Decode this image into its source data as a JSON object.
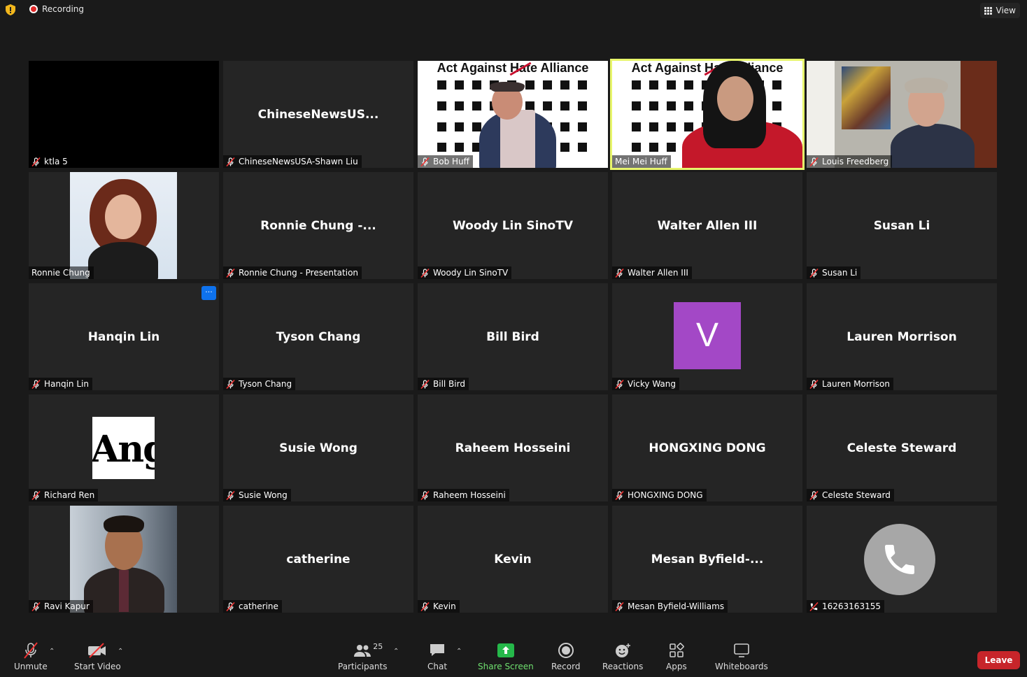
{
  "topbar": {
    "recording_label": "Recording",
    "view_label": "View"
  },
  "banner_text": "Act Against Hate Alliance",
  "tiles": [
    {
      "center": "",
      "name": "ktla 5"
    },
    {
      "center": "ChineseNewsUS...",
      "name": "ChineseNewsUSA-Shawn Liu"
    },
    {
      "center": "",
      "name": "Bob Huff"
    },
    {
      "center": "",
      "name": "Mei Mei Huff"
    },
    {
      "center": "",
      "name": "Louis Freedberg"
    },
    {
      "center": "",
      "name": "Ronnie Chung"
    },
    {
      "center": "Ronnie  Chung  -...",
      "name": "Ronnie Chung - Presentation"
    },
    {
      "center": "Woody Lin SinoTV",
      "name": "Woody Lin SinoTV"
    },
    {
      "center": "Walter Allen III",
      "name": "Walter Allen III"
    },
    {
      "center": "Susan Li",
      "name": "Susan Li"
    },
    {
      "center": "Hanqin Lin",
      "name": "Hanqin Lin",
      "more": "···"
    },
    {
      "center": "Tyson Chang",
      "name": "Tyson Chang"
    },
    {
      "center": "Bill Bird",
      "name": "Bill Bird"
    },
    {
      "center": "",
      "name": "Vicky Wang",
      "avatar_letter": "V"
    },
    {
      "center": "Lauren Morrison",
      "name": "Lauren Morrison"
    },
    {
      "center": "",
      "name": "Richard Ren",
      "logo_text": "Ang"
    },
    {
      "center": "Susie Wong",
      "name": "Susie Wong"
    },
    {
      "center": "Raheem Hosseini",
      "name": "Raheem Hosseini"
    },
    {
      "center": "HONGXING DONG",
      "name": "HONGXING DONG"
    },
    {
      "center": "Celeste Steward",
      "name": "Celeste Steward"
    },
    {
      "center": "",
      "name": "Ravi Kapur"
    },
    {
      "center": "catherine",
      "name": "catherine"
    },
    {
      "center": "Kevin",
      "name": "Kevin"
    },
    {
      "center": "Mesan  Byfield-...",
      "name": "Mesan Byfield-Williams"
    },
    {
      "center": "",
      "name": "16263163155"
    }
  ],
  "toolbar": {
    "unmute": "Unmute",
    "start_video": "Start Video",
    "participants": "Participants",
    "participant_count": "25",
    "chat": "Chat",
    "share_screen": "Share Screen",
    "record": "Record",
    "reactions": "Reactions",
    "apps": "Apps",
    "whiteboards": "Whiteboards",
    "leave": "Leave"
  },
  "colors": {
    "active_speaker_border": "#e7f56b",
    "leave_red": "#c7252a",
    "share_green": "#25b84a",
    "avatar_purple": "#a348c6",
    "more_blue": "#0e72ed"
  }
}
